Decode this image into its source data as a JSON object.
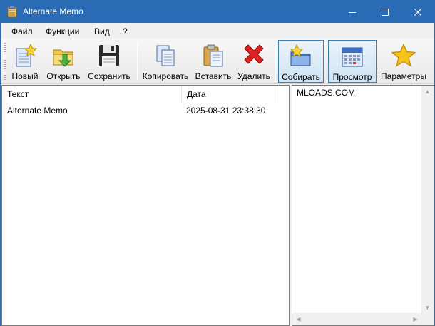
{
  "window": {
    "title": "Alternate Memo"
  },
  "menu": [
    {
      "label": "Файл"
    },
    {
      "label": "Функции"
    },
    {
      "label": "Вид"
    },
    {
      "label": "?"
    }
  ],
  "toolbar": {
    "new_label": "Новый",
    "open_label": "Открыть",
    "save_label": "Сохранить",
    "copy_label": "Копировать",
    "paste_label": "Вставить",
    "delete_label": "Удалить",
    "collect_label": "Собирать",
    "view_label": "Просмотр",
    "settings_label": "Параметры"
  },
  "list": {
    "columns": [
      "Текст",
      "Дата"
    ],
    "rows": [
      {
        "text": "Alternate Memo",
        "date": "2025-08-31 23:38:30"
      }
    ]
  },
  "preview": {
    "text": "MLOADS.COM"
  },
  "colors": {
    "titlebar": "#2a6bb5",
    "active_button_border": "#3c7fb1"
  }
}
